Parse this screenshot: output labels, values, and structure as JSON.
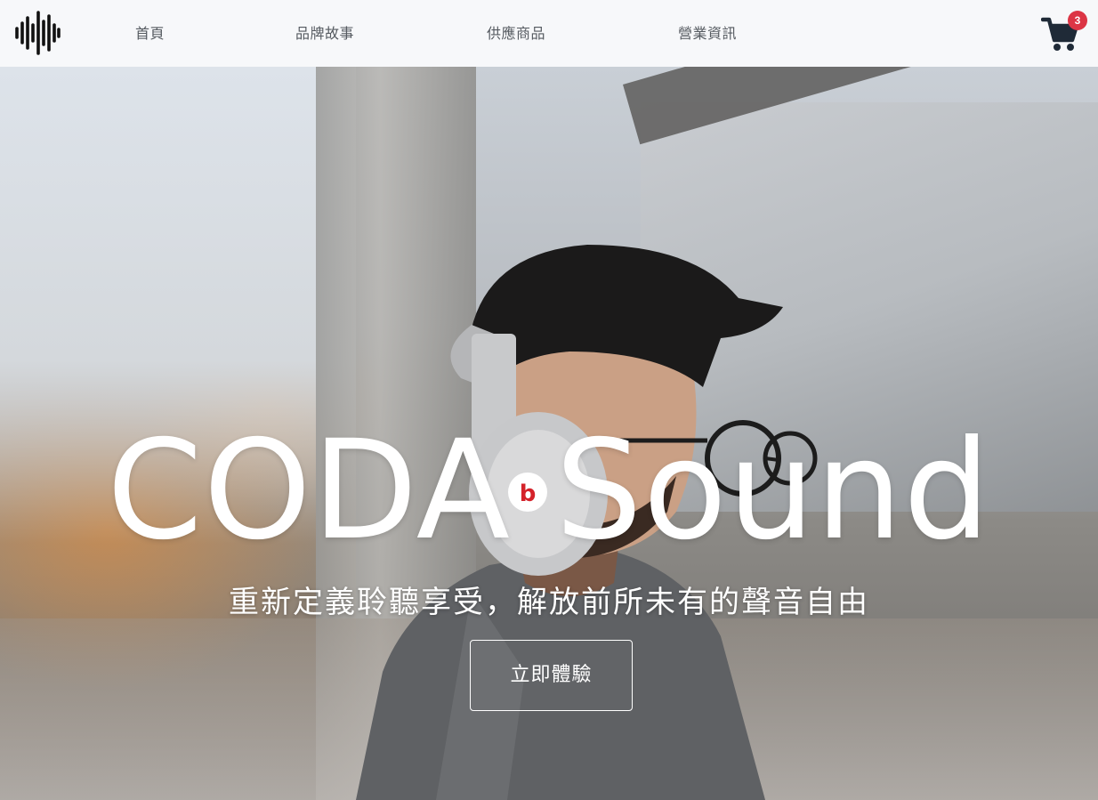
{
  "nav": {
    "links": [
      {
        "label": "首頁"
      },
      {
        "label": "品牌故事"
      },
      {
        "label": "供應商品"
      },
      {
        "label": "營業資訊"
      }
    ],
    "cart": {
      "count": "3",
      "icon": "shopping-cart-icon"
    },
    "logo_icon": "sound-wave-logo-icon"
  },
  "hero": {
    "title": "CODA Sound",
    "subtitle": "重新定義聆聽享受，解放前所未有的聲音自由",
    "cta_label": "立即體驗"
  },
  "colors": {
    "nav_background": "#f7f8fa",
    "nav_text": "#555a60",
    "cart_icon": "#1f2a37",
    "badge": "#dc3545",
    "hero_text": "#ffffff"
  }
}
